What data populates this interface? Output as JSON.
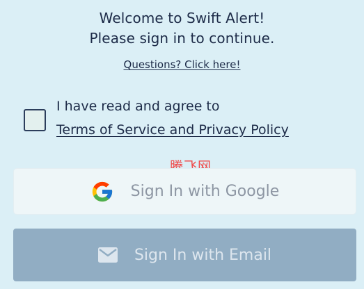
{
  "header": {
    "line1": "Welcome to Swift Alert!",
    "line2": "Please sign in to continue."
  },
  "help": {
    "questions_link": "Questions? Click here!"
  },
  "agreement": {
    "checked": false,
    "text": "I have read and agree to",
    "terms_link": "Terms of Service and Privacy Policy"
  },
  "watermark": "腾飞网",
  "buttons": {
    "google": {
      "label": "Sign In with Google",
      "icon": "google-g-icon"
    },
    "email": {
      "label": "Sign In with Email",
      "icon": "envelope-icon"
    }
  },
  "colors": {
    "background": "#dbeff6",
    "text": "#1d2b48",
    "google_button_bg": "#eef6f8",
    "email_button_bg": "#91adc3",
    "watermark": "#f04848"
  }
}
